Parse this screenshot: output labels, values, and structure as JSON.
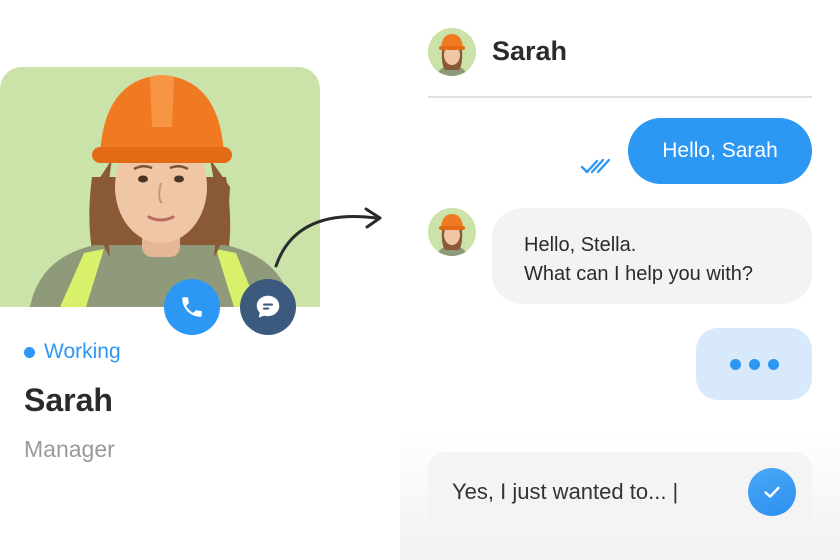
{
  "profile": {
    "status": "Working",
    "name": "Sarah",
    "role": "Manager"
  },
  "chat": {
    "header_name": "Sarah",
    "messages": [
      {
        "direction": "outgoing",
        "text": "Hello, Sarah"
      },
      {
        "direction": "incoming",
        "lines": [
          "Hello, Stella.",
          "What can I help you with?"
        ]
      }
    ],
    "composer_value": "Yes, I just wanted to... |"
  },
  "icons": {
    "call": "phone-icon",
    "message": "chat-bubble-icon",
    "read": "double-check-icon",
    "send": "check-icon"
  },
  "colors": {
    "accent": "#2d97f4",
    "message_button": "#3c5a7e",
    "photo_background": "#cbe3a9",
    "typing_bubble": "#d7e9fb",
    "incoming_bubble": "#f3f3f3"
  }
}
